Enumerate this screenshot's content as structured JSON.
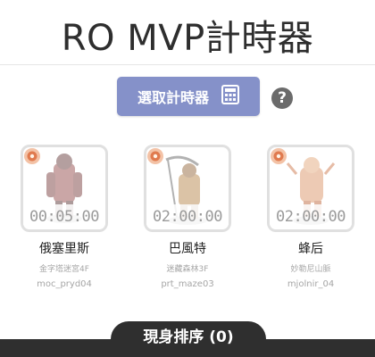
{
  "header": {
    "title": "RO MVP計時器"
  },
  "toolbar": {
    "select_label": "選取計時器",
    "select_icon": "calculator-icon",
    "help_label": "?"
  },
  "mvps": [
    {
      "name": "俄塞里斯",
      "map": "金字塔迷宮4F",
      "map_id": "moc_pryd04",
      "timer": "00:05:00"
    },
    {
      "name": "巴風特",
      "map": "迷藏森林3F",
      "map_id": "prt_maze03",
      "timer": "02:00:00"
    },
    {
      "name": "蜂后",
      "map": "妙勒尼山脈",
      "map_id": "mjolnir_04",
      "timer": "02:00:00"
    }
  ],
  "footer": {
    "order_label": "現身排序 (0)"
  },
  "colors": {
    "accent": "#8591c9",
    "bar": "#2f2f2f"
  }
}
